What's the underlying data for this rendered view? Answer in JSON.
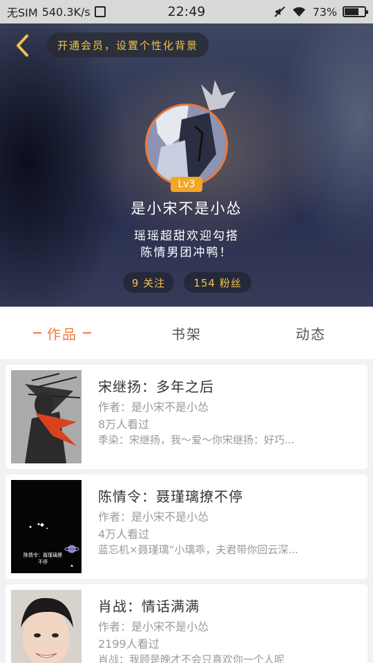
{
  "status_bar": {
    "carrier": "无SIM",
    "speed": "540.3K/s",
    "time": "22:49",
    "battery": "73%",
    "battery_level": 0.73
  },
  "header": {
    "vip_prompt": "开通会员，设置个性化背景",
    "level": "Lv3",
    "nickname": "是小宋不是小怂",
    "bio_line1": "瑶瑶超甜欢迎勾搭",
    "bio_line2": "陈情男团冲鸭！",
    "follow_count": "9 关注",
    "fans_count": "154 粉丝"
  },
  "tabs": [
    {
      "label": "作品",
      "active": true
    },
    {
      "label": "书架",
      "active": false
    },
    {
      "label": "动态",
      "active": false
    }
  ],
  "works": [
    {
      "title": "宋继扬：多年之后",
      "author": "作者：是小宋不是小怂",
      "views": "8万人看过",
      "desc": "季染：宋继扬，我～爱～你宋继扬：好巧..."
    },
    {
      "title": "陈情令：聂瑾璃撩不停",
      "author": "作者：是小宋不是小怂",
      "views": "4万人看过",
      "desc": "蓝忘机×聂瑾璃“小璃乖，夫君带你回云深...",
      "cover_text": "陈情令：聂瑾璃撩不停"
    },
    {
      "title": "肖战：情话满满",
      "author": "作者：是小宋不是小怂",
      "views": "2199人看过",
      "desc": "肖战：我顾是晚才不会只喜欢你一个人呢"
    }
  ],
  "colors": {
    "accent": "#ee7b3d",
    "gold": "#f1c34a",
    "level_badge": "#f3a726"
  }
}
